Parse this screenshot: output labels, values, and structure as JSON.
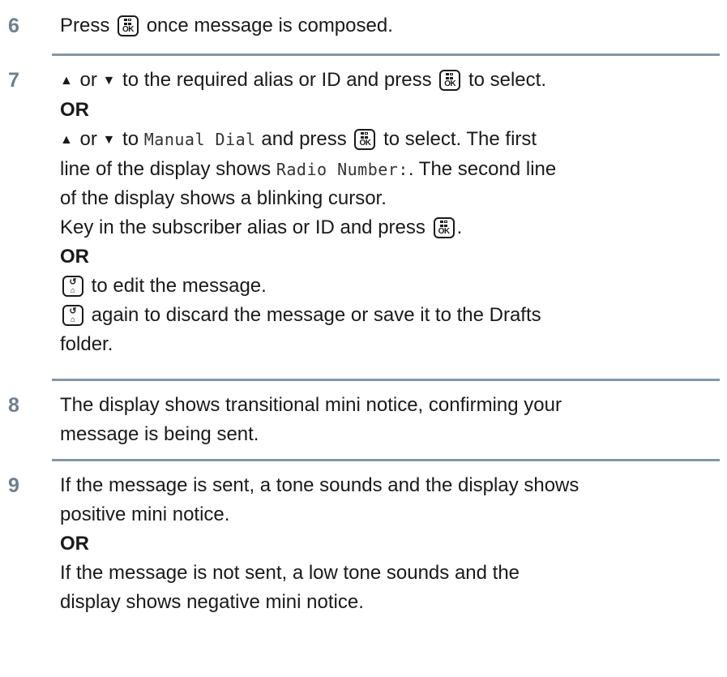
{
  "steps": [
    {
      "number": "6",
      "lines": {
        "l1": {
          "pre": "Press",
          "post": "once message is composed."
        }
      }
    },
    {
      "number": "7",
      "lines": {
        "l1": {
          "or1": "or",
          "post": "to the required alias or ID and press",
          "post2": "to select."
        },
        "or_a": "OR",
        "l2": {
          "or1": "or",
          "mid": "to",
          "mono": "Manual Dial",
          "mid2": "and press",
          "post": "to select. The first"
        },
        "l3": {
          "pre": "line of the display shows",
          "mono": "Radio Number:",
          "post": ". The second line"
        },
        "l4": "of the display shows a blinking cursor.",
        "l5": {
          "pre": "Key in the subscriber alias or ID and press",
          "post": "."
        },
        "or_b": "OR",
        "l6": {
          "post": "to edit the message."
        },
        "l7": {
          "post": "again to discard the message or save it to the Drafts"
        },
        "l8": "folder."
      }
    },
    {
      "number": "8",
      "lines": {
        "l1": "The display shows transitional mini notice, confirming your",
        "l2": "message is being sent."
      }
    },
    {
      "number": "9",
      "lines": {
        "l1": "If the message is sent, a tone sounds and the display shows",
        "l2": "positive mini notice.",
        "or_a": "OR",
        "l3": "If the message is not sent, a low tone sounds and the",
        "l4": "display shows negative mini notice."
      }
    }
  ],
  "icons": {
    "ok_button": {
      "name": "menu-ok-button-icon",
      "label": "OK"
    },
    "back_button": {
      "name": "back-home-button-icon",
      "top": "↺",
      "bottom": "⌂"
    },
    "up_arrow": "▲",
    "down_arrow": "▼"
  },
  "colors": {
    "step_number": "#6d8090",
    "separator": "#8497a6"
  }
}
